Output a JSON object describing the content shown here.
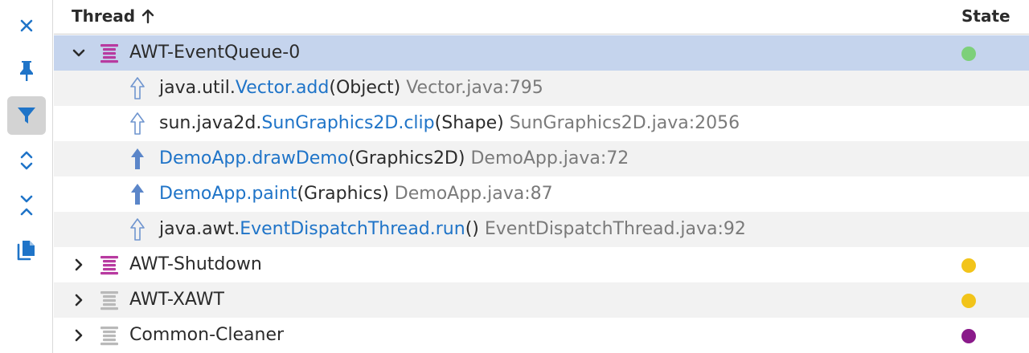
{
  "toolbar": {
    "buttons": [
      {
        "icon": "close-icon",
        "active": false
      },
      {
        "icon": "pin-icon",
        "active": false
      },
      {
        "icon": "filter-icon",
        "active": true
      },
      {
        "icon": "expand-icon",
        "active": false
      },
      {
        "icon": "collapse-icon",
        "active": false
      },
      {
        "icon": "copy-icon",
        "active": false
      }
    ]
  },
  "table": {
    "columns": {
      "thread": "Thread",
      "state": "State"
    },
    "sort_icon": "arrow-up-icon"
  },
  "threads": [
    {
      "name": "AWT-EventQueue-0",
      "expanded": true,
      "selected": true,
      "icon_color": "#b83aa0",
      "state_color": "#7dd07a",
      "frames": [
        {
          "pkg": "java.util.",
          "method": "Vector.add",
          "args": "(Object)",
          "loc": "Vector.java:795",
          "own": false
        },
        {
          "pkg": "sun.java2d.",
          "method": "SunGraphics2D.clip",
          "args": "(Shape)",
          "loc": "SunGraphics2D.java:2056",
          "own": false
        },
        {
          "pkg": "",
          "method": "DemoApp.drawDemo",
          "args": "(Graphics2D)",
          "loc": "DemoApp.java:72",
          "own": true
        },
        {
          "pkg": "",
          "method": "DemoApp.paint",
          "args": "(Graphics)",
          "loc": "DemoApp.java:87",
          "own": true
        },
        {
          "pkg": "java.awt.",
          "method": "EventDispatchThread.run",
          "args": "()",
          "loc": "EventDispatchThread.java:92",
          "own": false
        }
      ]
    },
    {
      "name": "AWT-Shutdown",
      "expanded": false,
      "selected": false,
      "icon_color": "#b83aa0",
      "state_color": "#f2c41a"
    },
    {
      "name": "AWT-XAWT",
      "expanded": false,
      "selected": false,
      "icon_color": "#b9b9b9",
      "state_color": "#f2c41a"
    },
    {
      "name": "Common-Cleaner",
      "expanded": false,
      "selected": false,
      "icon_color": "#b9b9b9",
      "state_color": "#8a1a8a"
    }
  ],
  "colors": {
    "accent": "#1f74c8",
    "selection": "#c5d4ed",
    "own_frame_arrow": "#5b86c9",
    "lib_frame_arrow": "#6f95cf"
  }
}
